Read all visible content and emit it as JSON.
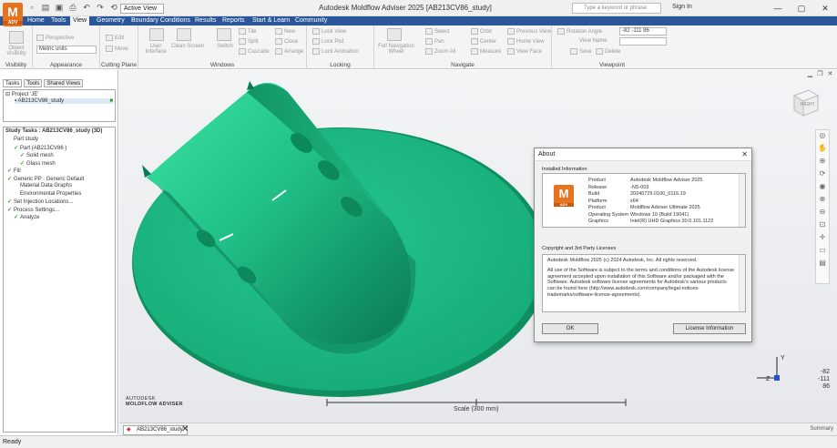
{
  "app": {
    "logo": "M",
    "logo_sub": "ADV",
    "title": "Autodesk Moldflow Adviser 2025  [AB213CV86_study]",
    "view_dropdown": "Active View",
    "search_placeholder": "Type a keyword or phrase",
    "sign_in": "Sign In"
  },
  "menu": {
    "tabs": [
      "Home",
      "Tools",
      "View",
      "Geometry",
      "Boundary Conditions",
      "Results",
      "Reports",
      "Start & Learn",
      "Community"
    ],
    "active": "View"
  },
  "ribbon": {
    "groups": [
      {
        "label": "Visibility",
        "buttons": [
          "Object Visibility"
        ]
      },
      {
        "label": "Appearance",
        "buttons": [
          "Perspective",
          "Metric units"
        ]
      },
      {
        "label": "Cutting Plane",
        "buttons": [
          "Edit",
          "Move"
        ]
      },
      {
        "label": "Windows",
        "buttons": [
          "User Interface",
          "Clean Screen",
          "Switch",
          "Tile",
          "Split",
          "Cascade",
          "New",
          "Close",
          "Arrange"
        ]
      },
      {
        "label": "Locking",
        "buttons": [
          "Lock View",
          "Lock Plot",
          "Lock Animation"
        ]
      },
      {
        "label": "Navigate",
        "buttons": [
          "Full Navigation Wheel",
          "Select",
          "Pan",
          "Zoom All",
          "Orbit",
          "Center",
          "Measure",
          "Previous View",
          "Home View",
          "View Face"
        ]
      },
      {
        "label": "Viewpoint",
        "buttons": [
          "Rotation Angle",
          "View Name",
          "Save",
          "Delete"
        ],
        "rotation_value": "-82 -111 86"
      }
    ]
  },
  "left_panel": {
    "tabs": [
      "Tasks",
      "Tools",
      "Shared Views"
    ],
    "project_label": "Project 'JE'",
    "study_item": "AB213CV86_study",
    "study_tasks_header": "Study Tasks : AB213CV86_study (3D)",
    "tasks": [
      {
        "label": "Part study",
        "check": false,
        "indent": 1
      },
      {
        "label": "Part (AB213CV86 )",
        "check": true,
        "indent": 1
      },
      {
        "label": "Solid mesh",
        "check": true,
        "indent": 2
      },
      {
        "label": "Glass mesh",
        "check": true,
        "indent": 2
      },
      {
        "label": "Fill",
        "check": true,
        "indent": 0
      },
      {
        "label": "Generic PP : Generic Default",
        "check": true,
        "indent": 0
      },
      {
        "label": "Material Data Graphs",
        "check": false,
        "indent": 2
      },
      {
        "label": "Environmental Properties",
        "check": false,
        "indent": 2
      },
      {
        "label": "Set Injection Locations...",
        "check": true,
        "indent": 0
      },
      {
        "label": "Process Settings...",
        "check": true,
        "indent": 0
      },
      {
        "label": "Analyze",
        "check": true,
        "indent": 1
      }
    ]
  },
  "viewport": {
    "viewcube_face": "RIGHT",
    "brand_line1": "AUTODESK",
    "brand_line2": "MOLDFLOW ADVISER",
    "scale": "Scale (300 mm)",
    "coords": [
      "-82",
      "-111",
      "86"
    ],
    "colors": {
      "part": "#1db584",
      "part_dark": "#0b7a52",
      "part_light": "#3fe6a8"
    }
  },
  "about": {
    "title": "About",
    "installed_header": "Installed Information",
    "fields": [
      {
        "k": "Product",
        "v": "Autodesk Moldflow Adviser 2025"
      },
      {
        "k": "Release",
        "v": "-NS-003"
      },
      {
        "k": "Build",
        "v": "20240729.0100_0116.19"
      },
      {
        "k": "Platform",
        "v": "x64"
      },
      {
        "k": "Product",
        "v": "Moldflow Adviser Ultimate 2025"
      },
      {
        "k": "Operating System",
        "v": "Windows 10 (Build 19041)"
      },
      {
        "k": "Graphics",
        "v": "Intel(R) UHD Graphics 30.0.101.1122"
      }
    ],
    "copyright_header": "Copyright and 3rd Party Licenses",
    "license_paragraphs": [
      "Autodesk Moldflow 2025 (c) 2024 Autodesk, Inc. All rights reserved.",
      "All use of the Software is subject to the terms and conditions of the Autodesk license agreement accepted upon installation of this Software and/or packaged with the Software. Autodesk software license agreements for Autodesk's various products can be found here (http://www.autodesk.com/company/legal-notices-trademarks/software-license-agreements)."
    ],
    "ok": "OK",
    "license_btn": "License Information"
  },
  "bottom": {
    "doc_tab": "AB213CV86_study",
    "summary": "Summary",
    "status": "Ready"
  }
}
